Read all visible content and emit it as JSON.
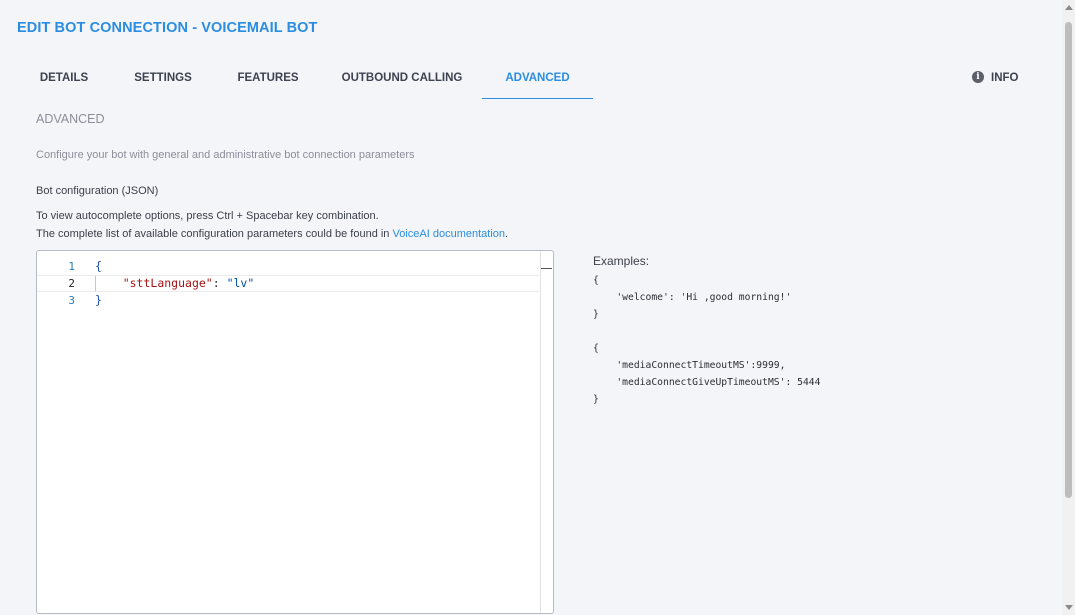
{
  "window": {
    "title": "EDIT BOT CONNECTION - VOICEMAIL BOT"
  },
  "tabs": [
    {
      "label": "DETAILS",
      "active": false
    },
    {
      "label": "SETTINGS",
      "active": false
    },
    {
      "label": "FEATURES",
      "active": false
    },
    {
      "label": "OUTBOUND CALLING",
      "active": false
    },
    {
      "label": "ADVANCED",
      "active": true
    }
  ],
  "info": {
    "label": "INFO",
    "icon": "info-icon"
  },
  "section": {
    "title": "ADVANCED",
    "description": "Configure your bot with general and administrative bot connection parameters"
  },
  "config": {
    "label": "Bot configuration (JSON)",
    "hint1": "To view autocomplete options, press Ctrl + Spacebar key combination.",
    "hint2_prefix": "The complete list of available configuration parameters could be found in ",
    "hint2_link": "VoiceAI documentation",
    "hint2_suffix": "."
  },
  "editor": {
    "line_numbers": [
      "1",
      "2",
      "3"
    ],
    "lines": {
      "open": "{",
      "key": "\"sttLanguage\"",
      "sep": ": ",
      "value": "\"lv\"",
      "close": "}"
    }
  },
  "examples": {
    "label": "Examples:",
    "code": "{\n    'welcome': 'Hi ,good morning!'\n}\n\n{\n    'mediaConnectTimeoutMS':9999,\n    'mediaConnectGiveUpTimeoutMS': 5444\n}"
  },
  "colors": {
    "accent": "#2a8de0",
    "background": "#f4f5f8"
  }
}
